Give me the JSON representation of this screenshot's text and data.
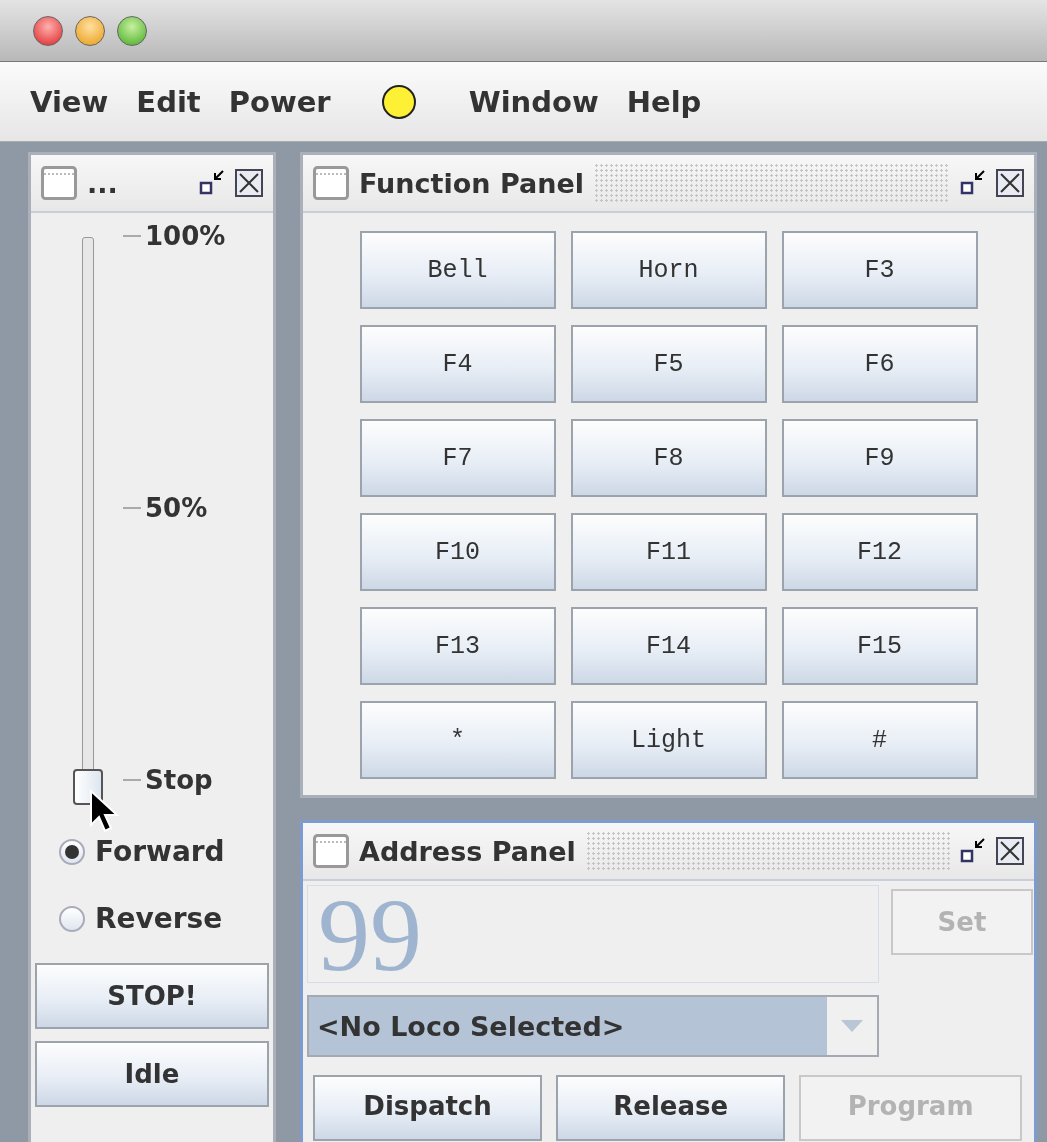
{
  "menu_bar": {
    "items": [
      {
        "label": "View"
      },
      {
        "label": "Edit"
      },
      {
        "label": "Power"
      },
      {
        "kind": "indicator"
      },
      {
        "label": "Window"
      },
      {
        "label": "Help"
      }
    ]
  },
  "throttle_frame": {
    "title": "...",
    "slider": {
      "level": 0,
      "ticks": [
        "100%",
        "50%",
        "Stop"
      ]
    },
    "direction": [
      {
        "label": "Forward",
        "selected": true
      },
      {
        "label": "Reverse",
        "selected": false
      }
    ],
    "buttons": [
      "STOP!",
      "Idle"
    ]
  },
  "function_panel": {
    "title": "Function Panel",
    "buttons": [
      "Bell",
      "Horn",
      "F3",
      "F4",
      "F5",
      "F6",
      "F7",
      "F8",
      "F9",
      "F10",
      "F11",
      "F12",
      "F13",
      "F14",
      "F15",
      "*",
      "Light",
      "#"
    ]
  },
  "address_panel": {
    "title": "Address Panel",
    "address": "99",
    "set_button": {
      "label": "Set",
      "disabled": true
    },
    "loco_select": "<No Loco Selected>",
    "buttons": [
      {
        "label": "Dispatch",
        "disabled": false
      },
      {
        "label": "Release",
        "disabled": false
      },
      {
        "label": "Program",
        "disabled": true
      }
    ]
  }
}
